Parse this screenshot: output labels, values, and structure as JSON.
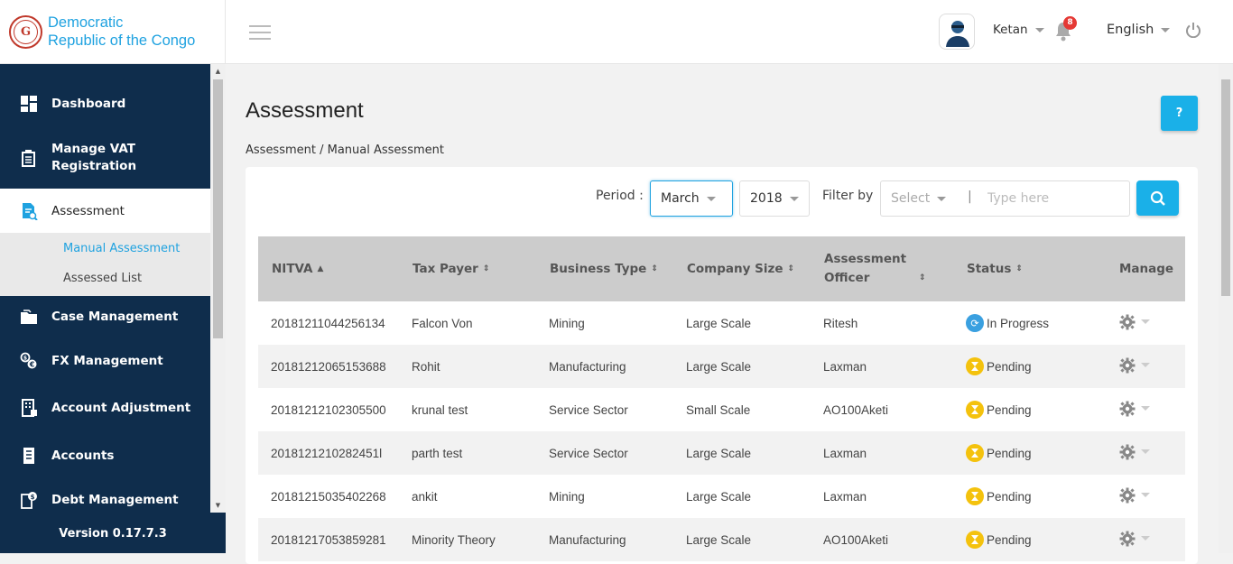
{
  "brand": {
    "line1": "Democratic",
    "line2": "Republic of the Congo",
    "color": "#1fa2e0"
  },
  "sidebar": {
    "items": [
      {
        "label": "Dashboard",
        "icon": "dashboard-icon"
      },
      {
        "label": "Manage VAT Registration",
        "icon": "document-icon"
      },
      {
        "label": "Assessment",
        "icon": "assessment-icon"
      },
      {
        "label": "Case Management",
        "icon": "folder-icon"
      },
      {
        "label": "FX Management",
        "icon": "exchange-icon"
      },
      {
        "label": "Account Adjustment",
        "icon": "building-icon"
      },
      {
        "label": "Accounts",
        "icon": "receipt-icon"
      },
      {
        "label": "Debt Management",
        "icon": "coins-icon"
      }
    ],
    "subitems": [
      {
        "label": "Manual Assessment"
      },
      {
        "label": "Assessed List"
      }
    ],
    "version": "Version 0.17.7.3",
    "bg_color": "#0f2d4c"
  },
  "header": {
    "user": "Ketan",
    "notifications": "8",
    "language": "English"
  },
  "page": {
    "title": "Assessment",
    "help": "?",
    "breadcrumb": "Assessment / Manual Assessment"
  },
  "filters": {
    "period_label": "Period :",
    "month": "March",
    "year": "2018",
    "filter_label": "Filter by",
    "filter_select": "Select",
    "filter_separator": "|",
    "placeholder": "Type here"
  },
  "table": {
    "headers": [
      "NITVA",
      "Tax Payer",
      "Business Type",
      "Company Size",
      "Assessment Officer",
      "Status",
      "Manage"
    ],
    "rows": [
      {
        "nitva": "20181211044256134",
        "payer": "Falcon Von",
        "business": "Mining",
        "size": "Large Scale",
        "officer": "Ritesh",
        "status": "In Progress"
      },
      {
        "nitva": "20181212065153688",
        "payer": "Rohit",
        "business": "Manufacturing",
        "size": "Large Scale",
        "officer": "Laxman",
        "status": "Pending"
      },
      {
        "nitva": "20181212102305500",
        "payer": "krunal test",
        "business": "Service Sector",
        "size": "Small Scale",
        "officer": "AO100Aketi",
        "status": "Pending"
      },
      {
        "nitva": "2018121210282451l",
        "payer": "parth test",
        "business": "Service Sector",
        "size": "Large Scale",
        "officer": "Laxman",
        "status": "Pending"
      },
      {
        "nitva": "20181215035402268",
        "payer": "ankit",
        "business": "Mining",
        "size": "Large Scale",
        "officer": "Laxman",
        "status": "Pending"
      },
      {
        "nitva": "20181217053859281",
        "payer": "Minority Theory",
        "business": "Manufacturing",
        "size": "Large Scale",
        "officer": "AO100Aketi",
        "status": "Pending"
      }
    ]
  }
}
